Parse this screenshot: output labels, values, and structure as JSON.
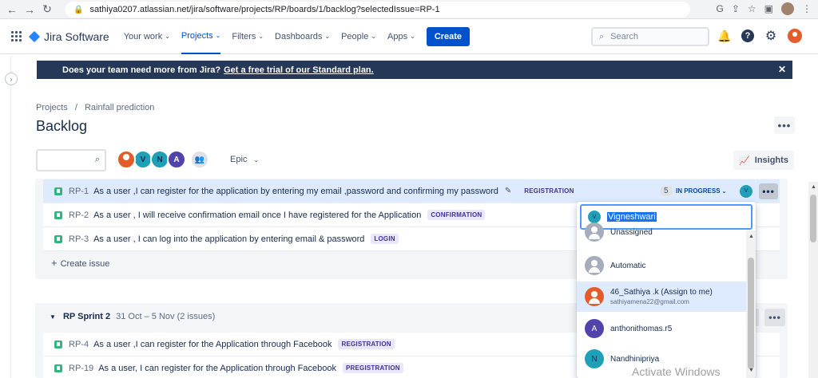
{
  "browser": {
    "url": "sathiya0207.atlassian.net/jira/software/projects/RP/boards/1/backlog?selectedIssue=RP-1"
  },
  "topnav": {
    "logo": "Jira Software",
    "items": [
      {
        "label": "Your work"
      },
      {
        "label": "Projects"
      },
      {
        "label": "Filters"
      },
      {
        "label": "Dashboards"
      },
      {
        "label": "People"
      },
      {
        "label": "Apps"
      }
    ],
    "create_label": "Create",
    "search_placeholder": "Search"
  },
  "banner": {
    "text": "Does your team need more from Jira?",
    "link": "Get a free trial of our Standard plan."
  },
  "breadcrumb": {
    "items": [
      "Projects",
      "Rainfall prediction"
    ]
  },
  "page_title": "Backlog",
  "filters": {
    "avatars": [
      "V",
      "N",
      "A"
    ],
    "epic_label": "Epic",
    "insights_label": "Insights"
  },
  "backlog": {
    "issues": [
      {
        "key": "RP-1",
        "summary": "As a user ,I can register for the application by entering my email ,password and confirming my password",
        "epic": "REGISTRATION",
        "points": "5",
        "status": "IN PROGRESS",
        "assignee": "V"
      },
      {
        "key": "RP-2",
        "summary": "As a user , I will receive confirmation email once I have registered for the Application",
        "epic": "CONFIRMATION"
      },
      {
        "key": "RP-3",
        "summary": "As a user , I can log into the application by entering email & password",
        "epic": "LOGIN"
      }
    ],
    "create_issue_label": "Create issue"
  },
  "sprint": {
    "name": "RP Sprint 2",
    "dates": "31 Oct – 5 Nov",
    "count": "(2 issues)",
    "issues": [
      {
        "key": "RP-4",
        "summary": "As a user ,I can register for the Application through Facebook",
        "epic": "REGISTRATION"
      },
      {
        "key": "RP-19",
        "summary": "As a user, I can register for the Application through Facebook",
        "epic": "PREGISTRATION"
      }
    ]
  },
  "assignee_dropdown": {
    "input_value": "Vigneshwari",
    "input_avatar": "V",
    "options": [
      {
        "name": "Unassigned"
      },
      {
        "name": "Automatic"
      },
      {
        "name": "46_Sathiya .k (Assign to me)",
        "email": "sathiyamena22@gmail.com"
      },
      {
        "name": "anthonithomas.r5",
        "initial": "A"
      },
      {
        "name": "Nandhinipriya",
        "initial": "N"
      }
    ]
  },
  "watermark": "Activate Windows",
  "colors": {
    "brand": "#0052cc",
    "banner_bg": "#253858",
    "selected_row": "#deebff",
    "epic_bg": "#eae6ff",
    "epic_text": "#403294"
  }
}
